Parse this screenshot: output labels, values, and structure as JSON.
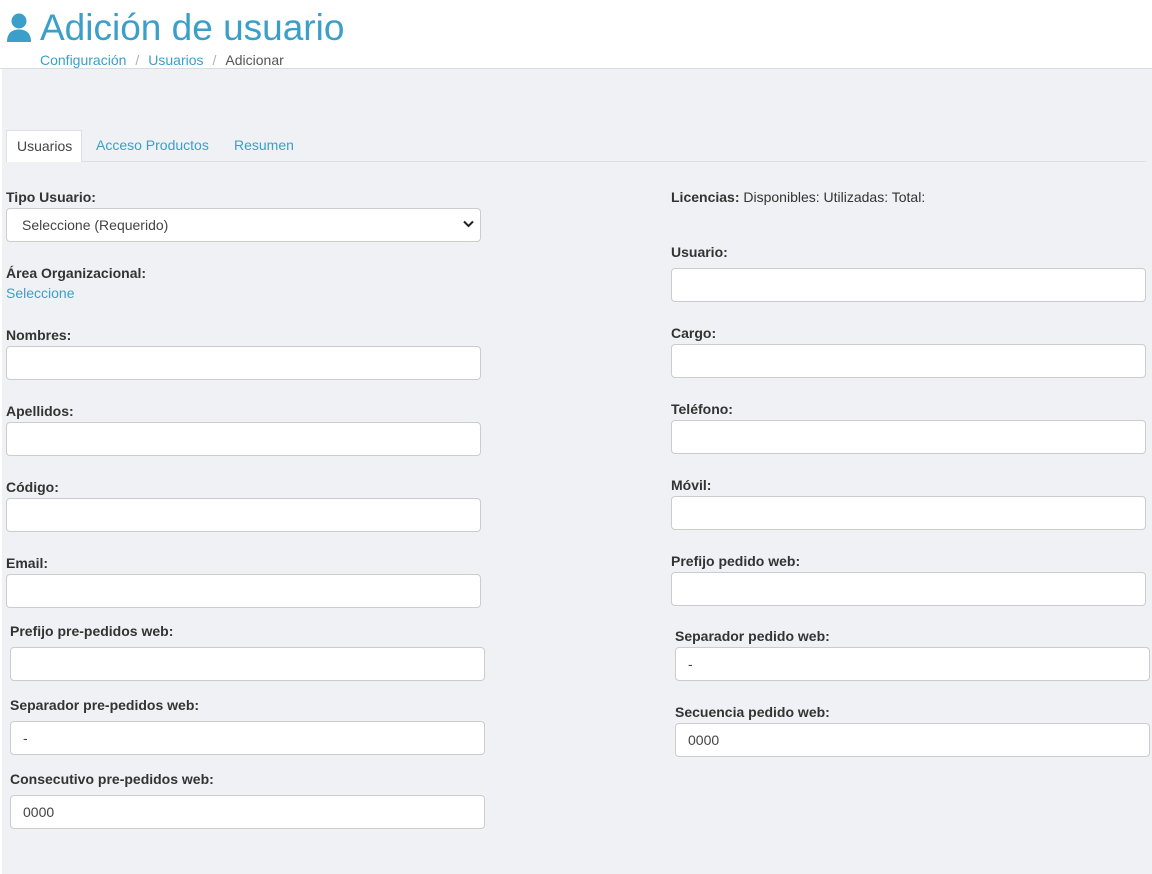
{
  "header": {
    "title": "Adición de usuario",
    "breadcrumb": [
      "Configuración",
      "Usuarios",
      "Adicionar"
    ]
  },
  "tabs": [
    "Usuarios",
    "Acceso Productos",
    "Resumen"
  ],
  "left": {
    "tipo_usuario": {
      "label": "Tipo Usuario:",
      "selected": "Seleccione (Requerido)"
    },
    "area": {
      "label": "Área Organizacional:",
      "link": "Seleccione"
    },
    "nombres": {
      "label": "Nombres:",
      "value": ""
    },
    "apellidos": {
      "label": "Apellidos:",
      "value": ""
    },
    "codigo": {
      "label": "Código:",
      "value": ""
    },
    "email": {
      "label": "Email:",
      "value": ""
    },
    "prefijo_pre": {
      "label": "Prefijo pre-pedidos web:",
      "value": ""
    },
    "separador_pre": {
      "label": "Separador pre-pedidos web:",
      "value": "-"
    },
    "consecutivo_pre": {
      "label": "Consecutivo pre-pedidos web:",
      "value": "0000"
    }
  },
  "right": {
    "licencias": {
      "label": "Licencias:",
      "text": "Disponibles: Utilizadas: Total:"
    },
    "usuario": {
      "label": "Usuario:",
      "value": ""
    },
    "cargo": {
      "label": "Cargo:",
      "value": ""
    },
    "telefono": {
      "label": "Teléfono:",
      "value": ""
    },
    "movil": {
      "label": "Móvil:",
      "value": ""
    },
    "prefijo_web": {
      "label": "Prefijo pedido web:",
      "value": ""
    },
    "separador_web": {
      "label": "Separador pedido web:",
      "value": "-"
    },
    "secuencia_web": {
      "label": "Secuencia pedido web:",
      "value": "0000"
    }
  },
  "colors": {
    "accent": "#3b9fc9",
    "panel": "#f0f1f5",
    "border": "#cccccc"
  },
  "icons": {
    "title": "user-icon",
    "select": "chevron-down-icon"
  }
}
